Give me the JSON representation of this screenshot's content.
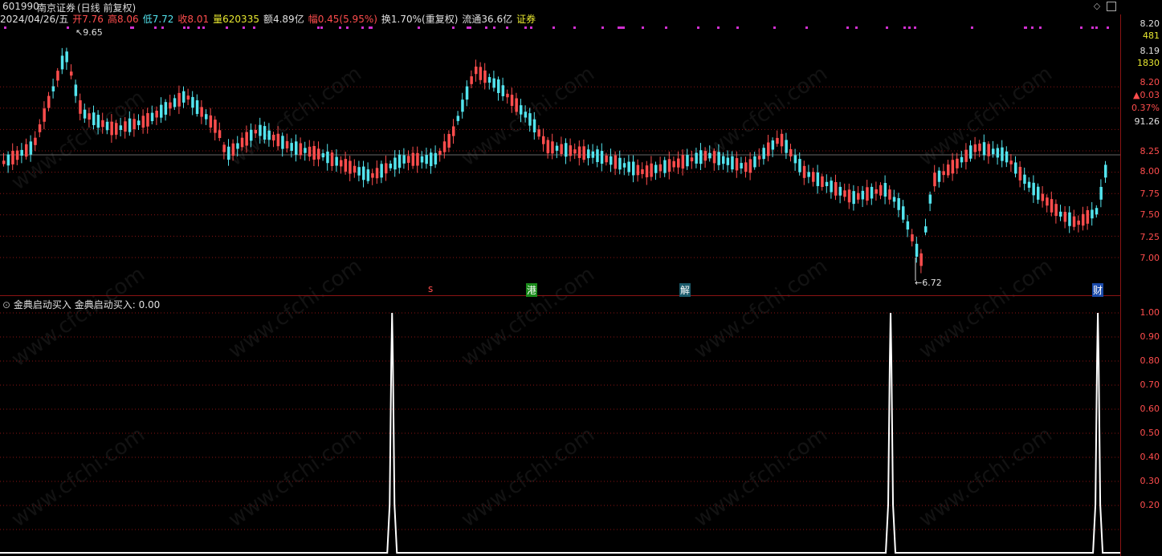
{
  "title": {
    "code": "601990",
    "name": "南京证券",
    "period": "(日线 前复权)"
  },
  "info": {
    "date": "2024/04/26/五",
    "open": "开7.76",
    "high": "高8.06",
    "low": "低7.72",
    "close": "收8.01",
    "volume": "量620335",
    "amount": "额4.89亿",
    "change": "幅0.45(5.95%)",
    "turnover": "换1.70%(重复权)",
    "float": "流通36.6亿",
    "sector": "证券"
  },
  "price_axis": {
    "top_labels": [
      "8.20",
      "481",
      "8.19",
      "1830",
      "8.20",
      "▲0.03",
      "0.37%",
      "91.26"
    ],
    "ticks": [
      "8.25",
      "8.00",
      "7.75",
      "7.50",
      "7.25",
      "7.00"
    ]
  },
  "annotations": {
    "max_label": "9.65",
    "min_label": "6.72"
  },
  "event_markers": [
    "s",
    "港",
    "解",
    "财"
  ],
  "indicator": {
    "name": "金典启动买入",
    "value_text": "金典启动买入: 0.00",
    "ticks": [
      "1.00",
      "0.90",
      "0.80",
      "0.70",
      "0.60",
      "0.50",
      "0.40",
      "0.30",
      "0.20"
    ]
  },
  "watermark": "www.cfchi.com",
  "colors": {
    "up": "#ff4d4d",
    "down": "#53e4ee",
    "grid": "#8a1414",
    "line": "#ffffff",
    "accent_yellow": "#e8e830"
  },
  "chart_data": [
    {
      "type": "candlestick",
      "title": "601990 南京证券 (日线 前复权)",
      "ylim": [
        6.72,
        9.65
      ],
      "y_ticks": [
        7.0,
        7.25,
        7.5,
        7.75,
        8.0,
        8.25
      ],
      "extremes": {
        "high": 9.65,
        "low": 6.72
      },
      "last_bar": {
        "open": 7.76,
        "high": 8.06,
        "low": 7.72,
        "close": 8.01
      }
    },
    {
      "type": "line",
      "series": [
        {
          "name": "金典启动买入",
          "signal_positions": [
            0.35,
            0.795,
            0.98
          ],
          "signal_value": 1.0,
          "baseline": 0.0
        }
      ],
      "ylim": [
        0,
        1.0
      ]
    }
  ]
}
